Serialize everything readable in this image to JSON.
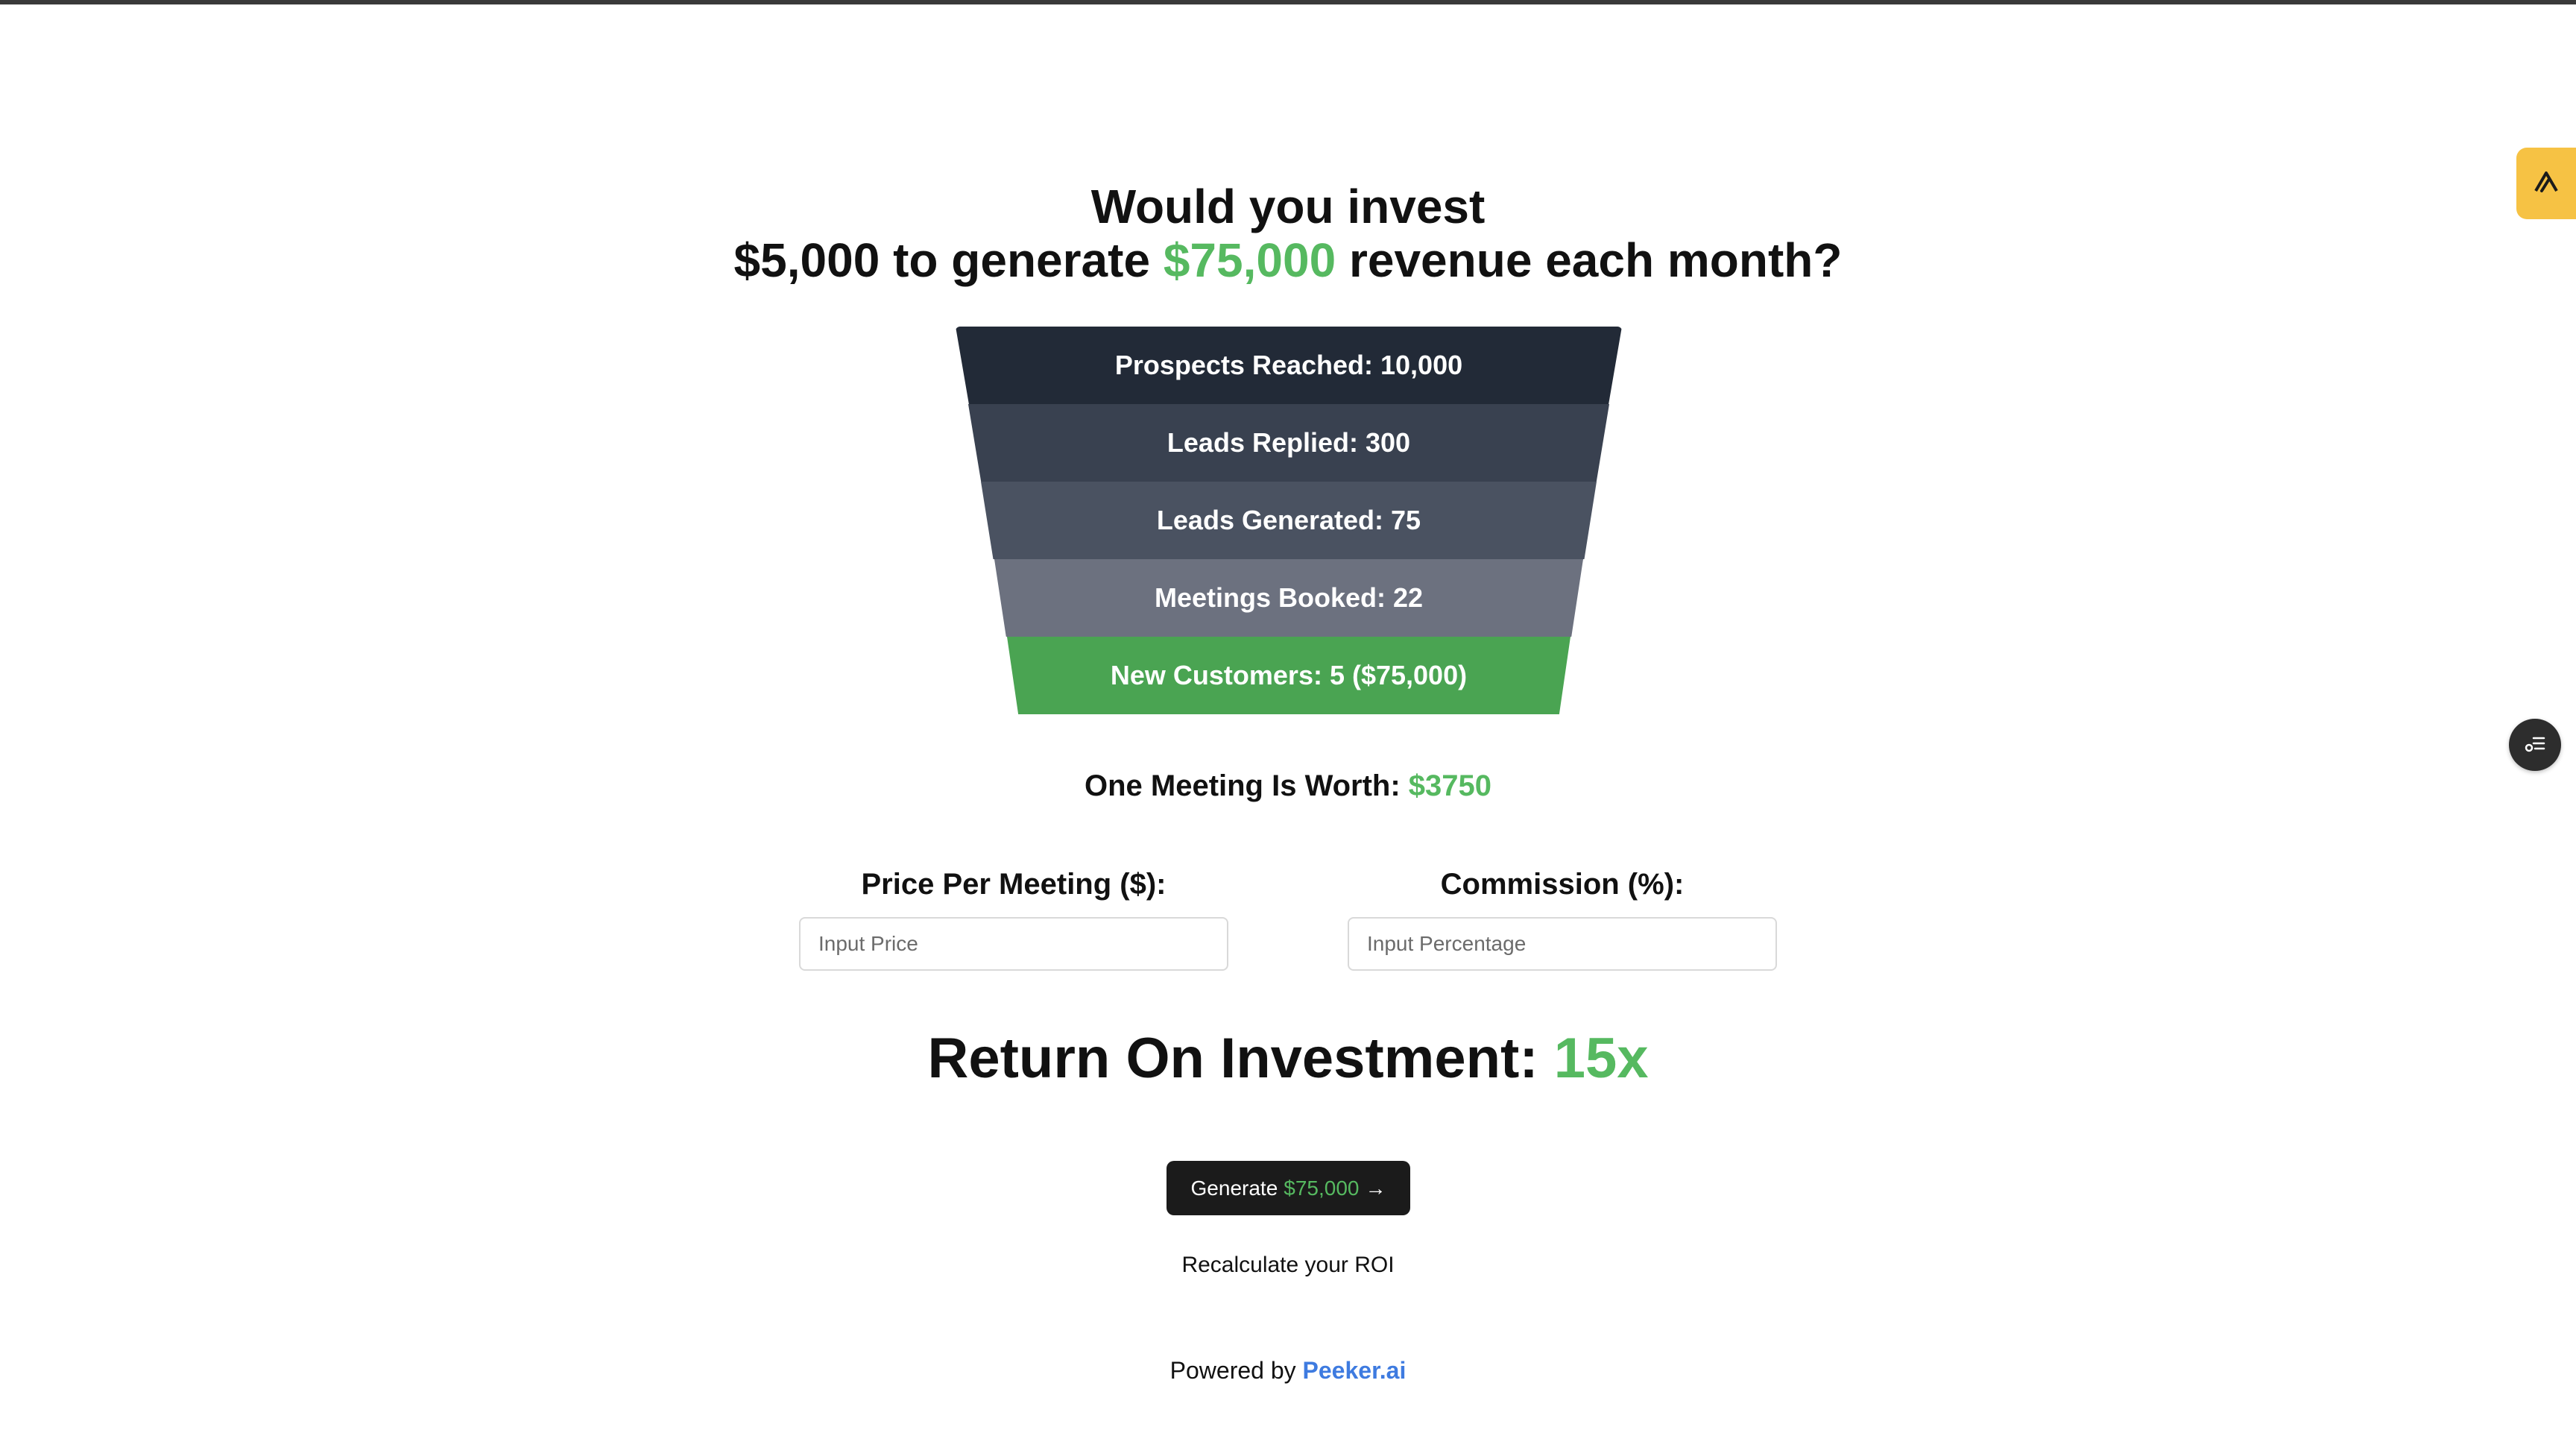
{
  "headline": {
    "line1": "Would you invest",
    "line2_prefix": "$5,000 to generate ",
    "line2_highlight": "$75,000",
    "line2_suffix": " revenue each month?"
  },
  "funnel": {
    "stages": [
      {
        "label": "Prospects Reached: 10,000"
      },
      {
        "label": "Leads Replied: 300"
      },
      {
        "label": "Leads Generated: 75"
      },
      {
        "label": "Meetings Booked: 22"
      },
      {
        "label": "New Customers: 5 ($75,000)"
      }
    ]
  },
  "meeting_worth": {
    "label": "One Meeting Is Worth: ",
    "value": "$3750"
  },
  "inputs": {
    "price": {
      "label": "Price Per Meeting ($):",
      "placeholder": "Input Price"
    },
    "commission": {
      "label": "Commission (%):",
      "placeholder": "Input Percentage"
    }
  },
  "roi": {
    "label": "Return On Investment: ",
    "value": "15x"
  },
  "generate_button": {
    "prefix": "Generate",
    "amount": "$75,000",
    "arrow": "→"
  },
  "recalculate": "Recalculate your ROI",
  "footer": {
    "prefix": "Powered by ",
    "brand": "Peeker.ai"
  },
  "icons": {
    "side_tab": "peeker-logo-icon",
    "side_round": "checklist-icon"
  },
  "colors": {
    "accent_green": "#56b960",
    "link_blue": "#3e7be0",
    "side_tab_yellow": "#f6c244"
  }
}
